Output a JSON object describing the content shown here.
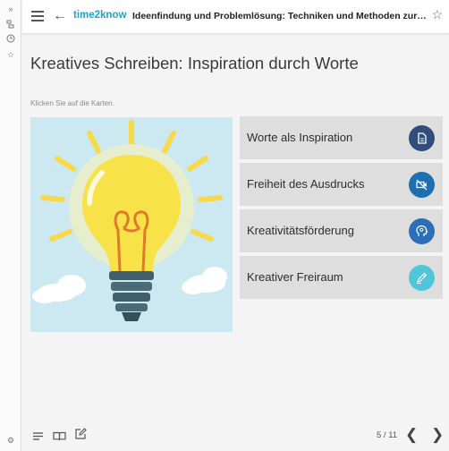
{
  "header": {
    "brand": "time2know",
    "course_title": "Ideenfindung und Problemlösung: Techniken und Methoden zur Steigerung der Kreativität"
  },
  "page": {
    "title": "Kreatives Schreiben: Inspiration durch Worte",
    "instruction": "Klicken Sie auf die Karten."
  },
  "image": {
    "alt": "lightbulb-illustration",
    "background": "#c9e6f0"
  },
  "cards": [
    {
      "label": "Worte als Inspiration",
      "icon": "document-icon",
      "color": "#2f4f7a"
    },
    {
      "label": "Freiheit des Ausdrucks",
      "icon": "video-off-icon",
      "color": "#1c6fb0"
    },
    {
      "label": "Kreativitätsförderung",
      "icon": "head-idea-icon",
      "color": "#2c6fb8"
    },
    {
      "label": "Kreativer Freiraum",
      "icon": "pen-icon",
      "color": "#4fc6d8"
    }
  ],
  "footer": {
    "pager": "5 / 11"
  }
}
